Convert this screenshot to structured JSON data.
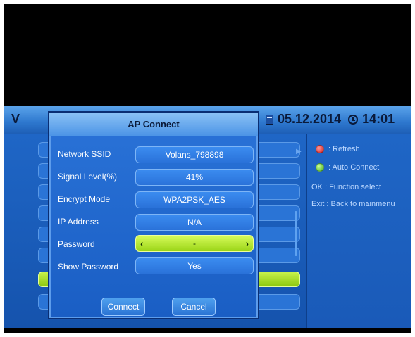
{
  "header": {
    "title_partial": "V",
    "date": "05.12.2014",
    "time": "14:01",
    "calendar_icon": "calendar-icon",
    "clock_icon": "clock-icon"
  },
  "dialog": {
    "title": "AP Connect",
    "rows": [
      {
        "label": "Network SSID",
        "value": "Volans_798898"
      },
      {
        "label": "Signal Level(%)",
        "value": "41%"
      },
      {
        "label": "Encrypt Mode",
        "value": "WPA2PSK_AES"
      },
      {
        "label": "IP Address",
        "value": "N/A"
      },
      {
        "label": "Password",
        "value": "-"
      },
      {
        "label": "Show Password",
        "value": "Yes"
      }
    ],
    "connect_label": "Connect",
    "cancel_label": "Cancel"
  },
  "legend": [
    {
      "key": "",
      "text": ": Refresh",
      "icon": "red-dot-icon"
    },
    {
      "key": "",
      "text": ": Auto Connect",
      "icon": "green-dot-icon"
    },
    {
      "key": "OK",
      "text": ": Function select"
    },
    {
      "key": "Exit",
      "text": ": Back to mainmenu"
    }
  ],
  "colors": {
    "panel_blue": "#1f66c6",
    "focus_green": "#9bd517",
    "header_blue": "#2f79cf"
  }
}
